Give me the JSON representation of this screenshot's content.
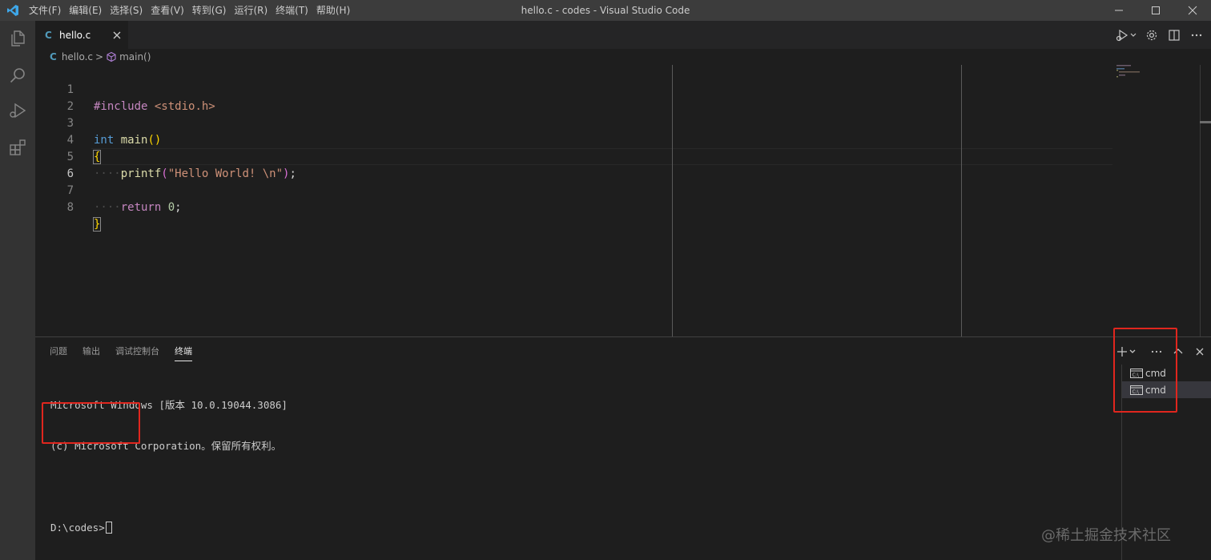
{
  "titlebar": {
    "title": "hello.c - codes - Visual Studio Code",
    "menu": [
      "文件(F)",
      "编辑(E)",
      "选择(S)",
      "查看(V)",
      "转到(G)",
      "运行(R)",
      "终端(T)",
      "帮助(H)"
    ]
  },
  "tab": {
    "icon_letter": "C",
    "label": "hello.c"
  },
  "breadcrumb": {
    "icon_letter": "C",
    "file": "hello.c",
    "separator": ">",
    "symbol": "main()"
  },
  "editor": {
    "lines": [
      {
        "n": "1"
      },
      {
        "n": "2"
      },
      {
        "n": "3"
      },
      {
        "n": "4"
      },
      {
        "n": "5"
      },
      {
        "n": "6"
      },
      {
        "n": "7"
      },
      {
        "n": "8"
      }
    ],
    "code": {
      "l1_directive": "#include",
      "l1_header": " <stdio.h>",
      "l3_type": "int",
      "l3_fn": " main",
      "l3_parens": "()",
      "l4_brace": "{",
      "l5_indent": "····",
      "l5_fn": "printf",
      "l5_open": "(",
      "l5_str": "\"Hello World! \\n\"",
      "l5_close": ")",
      "l5_semi": ";",
      "l7_indent": "····",
      "l7_kw": "return",
      "l7_space": " ",
      "l7_num": "0",
      "l7_semi": ";",
      "l8_brace": "}"
    }
  },
  "panel": {
    "tabs": [
      "问题",
      "输出",
      "调试控制台",
      "终端"
    ],
    "active_tab": "终端",
    "terminal_lines": [
      "Microsoft Windows [版本 10.0.19044.3086]",
      "(c) Microsoft Corporation。保留所有权利。",
      "",
      "D:\\codes>"
    ],
    "terminals": [
      {
        "name": "cmd"
      },
      {
        "name": "cmd"
      }
    ]
  },
  "watermark": "@稀土掘金技术社区",
  "colors": {
    "accent_red": "#e0261e",
    "title_bar": "#3c3c3c",
    "activity_bar": "#333333",
    "editor_bg": "#1e1e1e"
  }
}
